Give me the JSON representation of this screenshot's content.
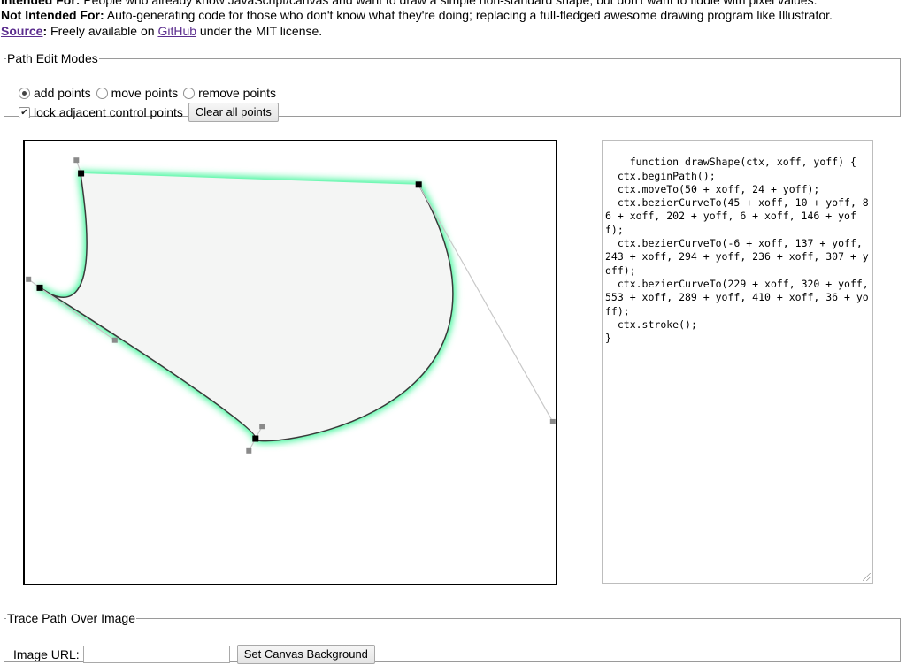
{
  "info": {
    "intended_label": "Intended For:",
    "intended_text": "People who already know JavaScript/canvas and want to draw a simple non-standard shape, but don't want to fiddle with pixel values.",
    "not_intended_label": "Not Intended For:",
    "not_intended_text": "Auto-generating code for those who don't know what they're doing; replacing a full-fledged awesome drawing program like Illustrator.",
    "source_label": "Source",
    "source_colon": ":",
    "source_text_1": "Freely available on",
    "github_link": "GitHub",
    "source_text_2": "under the MIT license."
  },
  "modes": {
    "legend": "Path Edit Modes",
    "options": [
      {
        "label": "add points",
        "checked": true
      },
      {
        "label": "move points",
        "checked": false
      },
      {
        "label": "remove points",
        "checked": false
      }
    ],
    "lock_label": "lock adjacent control points",
    "lock_checked": true,
    "clear_button": "Clear all points"
  },
  "canvas": {
    "xoff": 10,
    "yoff": 10,
    "fill_color": "#f4f5f4",
    "glow_color": "#3ff59a",
    "path_color": "#3a3a3a",
    "anchor_color": "#000000",
    "control_color": "#8a8a8a",
    "handle_line_color": "#c8c8c8",
    "move_to": [
      50,
      24
    ],
    "curves": [
      [
        45,
        10,
        86,
        202,
        6,
        146
      ],
      [
        -6,
        137,
        243,
        294,
        236,
        307
      ],
      [
        229,
        320,
        553,
        289,
        410,
        36
      ]
    ]
  },
  "code": {
    "text": "function drawShape(ctx, xoff, yoff) {\n  ctx.beginPath();\n  ctx.moveTo(50 + xoff, 24 + yoff);\n  ctx.bezierCurveTo(45 + xoff, 10 + yoff, 86 + xoff, 202 + yoff, 6 + xoff, 146 + yoff);\n  ctx.bezierCurveTo(-6 + xoff, 137 + yoff, 243 + xoff, 294 + yoff, 236 + xoff, 307 + yoff);\n  ctx.bezierCurveTo(229 + xoff, 320 + yoff, 553 + xoff, 289 + yoff, 410 + xoff, 36 + yoff);\n  ctx.stroke();\n}"
  },
  "trace": {
    "legend": "Trace Path Over Image",
    "url_label": "Image URL:",
    "url_value": "",
    "set_button": "Set Canvas Background"
  }
}
